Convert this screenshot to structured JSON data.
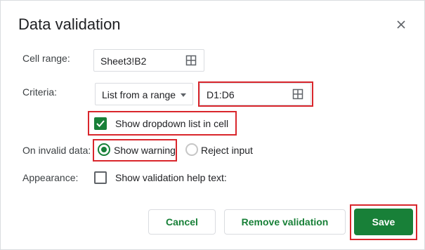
{
  "dialog": {
    "title": "Data validation",
    "close_icon": "close-icon"
  },
  "cell_range": {
    "label": "Cell range:",
    "value": "Sheet3!B2",
    "icon": "grid-select-icon"
  },
  "criteria": {
    "label": "Criteria:",
    "type_value": "List from a range",
    "range_value": "D1:D6",
    "icon": "grid-select-icon"
  },
  "show_dropdown": {
    "label": "Show dropdown list in cell",
    "checked": true
  },
  "on_invalid": {
    "label": "On invalid data:",
    "options": [
      {
        "label": "Show warning",
        "selected": true
      },
      {
        "label": "Reject input",
        "selected": false
      }
    ]
  },
  "appearance": {
    "label": "Appearance:",
    "checkbox_label": "Show validation help text:",
    "checked": false
  },
  "buttons": {
    "cancel": "Cancel",
    "remove": "Remove validation",
    "save": "Save"
  },
  "colors": {
    "accent": "#188038",
    "highlight": "#d9262c",
    "border": "#dadce0"
  }
}
